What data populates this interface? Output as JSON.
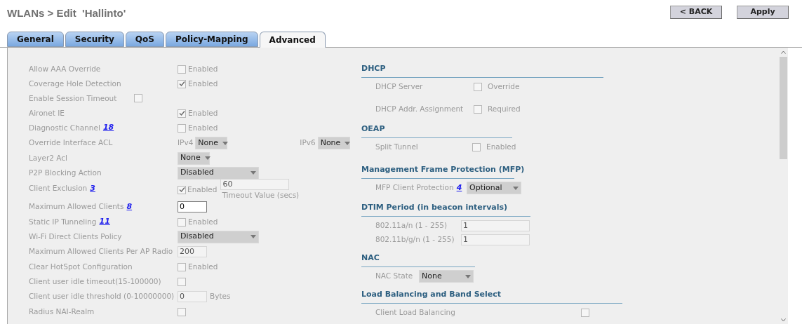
{
  "page_title": "WLANs > Edit  'Hallinto'",
  "buttons": [
    "< BACK",
    "Apply"
  ],
  "tabs": [
    {
      "label": "General",
      "selected": false
    },
    {
      "label": "Security",
      "selected": false
    },
    {
      "label": "QoS",
      "selected": false
    },
    {
      "label": "Policy-Mapping",
      "selected": false
    },
    {
      "label": "Advanced",
      "selected": true
    }
  ],
  "left_rows": [
    {
      "kind": "check",
      "label": "Allow AAA Override",
      "checked": false,
      "option": "Enabled"
    },
    {
      "kind": "check",
      "label": "Coverage Hole Detection",
      "checked": true,
      "option": "Enabled"
    },
    {
      "kind": "inline_check",
      "label": "Enable Session Timeout",
      "checked": false
    },
    {
      "kind": "check",
      "label": "Aironet IE",
      "checked": true,
      "option": "Enabled"
    },
    {
      "kind": "check",
      "label": "Diagnostic Channel",
      "note": "18",
      "checked": false,
      "option": "Enabled"
    },
    {
      "kind": "acl",
      "label": "Override Interface ACL",
      "ipv4_label": "IPv4",
      "ipv4_value": "None",
      "ipv6_label": "IPv6",
      "ipv6_value": "None"
    },
    {
      "kind": "select",
      "label": "Layer2 Acl",
      "value": "None"
    },
    {
      "kind": "wide_select",
      "label": "P2P Blocking Action",
      "value": "Disabled"
    },
    {
      "kind": "exclusion",
      "label": "Client Exclusion",
      "note": "3",
      "checked": true,
      "option": "Enabled",
      "timeout_value": "60",
      "timeout_caption": "Timeout Value (secs)"
    },
    {
      "kind": "input",
      "label": "Maximum Allowed Clients",
      "note": "8",
      "value": "0",
      "disabled": false
    },
    {
      "kind": "check",
      "label": "Static IP Tunneling",
      "note": "11",
      "checked": false,
      "option": "Enabled"
    },
    {
      "kind": "wide_select",
      "label": "Wi-Fi Direct Clients Policy",
      "value": "Disabled"
    },
    {
      "kind": "input",
      "label": "Maximum Allowed Clients Per AP Radio",
      "value": "200",
      "disabled": true
    },
    {
      "kind": "check",
      "label": "Clear HotSpot Configuration",
      "checked": false,
      "option": "Enabled"
    },
    {
      "kind": "check",
      "label": "Client user idle timeout(15-100000)",
      "checked": false
    },
    {
      "kind": "input",
      "label": "Client user idle threshold (0-10000000)",
      "value": "0",
      "disabled": true,
      "unit": "Bytes"
    },
    {
      "kind": "check",
      "label": "Radius NAI-Realm",
      "checked": false
    }
  ],
  "sections": [
    {
      "title": "DHCP",
      "rows": [
        {
          "kind": "check",
          "label": "DHCP Server",
          "checked": false,
          "option": "Override"
        },
        {
          "kind": "check",
          "label": "DHCP Addr. Assignment",
          "checked": false,
          "option": "Required"
        }
      ]
    },
    {
      "title": "OEAP",
      "rows": [
        {
          "kind": "check",
          "label": "Split Tunnel",
          "checked": false,
          "option": "Enabled"
        }
      ]
    },
    {
      "title": "Management Frame Protection (MFP)",
      "rows": [
        {
          "kind": "select",
          "label": "MFP Client Protection",
          "note": "4",
          "value": "Optional"
        }
      ]
    },
    {
      "title": "DTIM Period (in beacon intervals)",
      "rows": [
        {
          "kind": "input",
          "label": "802.11a/n (1 - 255)",
          "value": "1"
        },
        {
          "kind": "input",
          "label": "802.11b/g/n (1 - 255)",
          "value": "1"
        }
      ]
    },
    {
      "title": "NAC",
      "rows": [
        {
          "kind": "select",
          "label": "NAC State",
          "value": "None"
        }
      ]
    },
    {
      "title": "Load Balancing and Band Select",
      "rows": [
        {
          "kind": "check",
          "label": "Client Load Balancing",
          "checked": false
        }
      ]
    }
  ]
}
